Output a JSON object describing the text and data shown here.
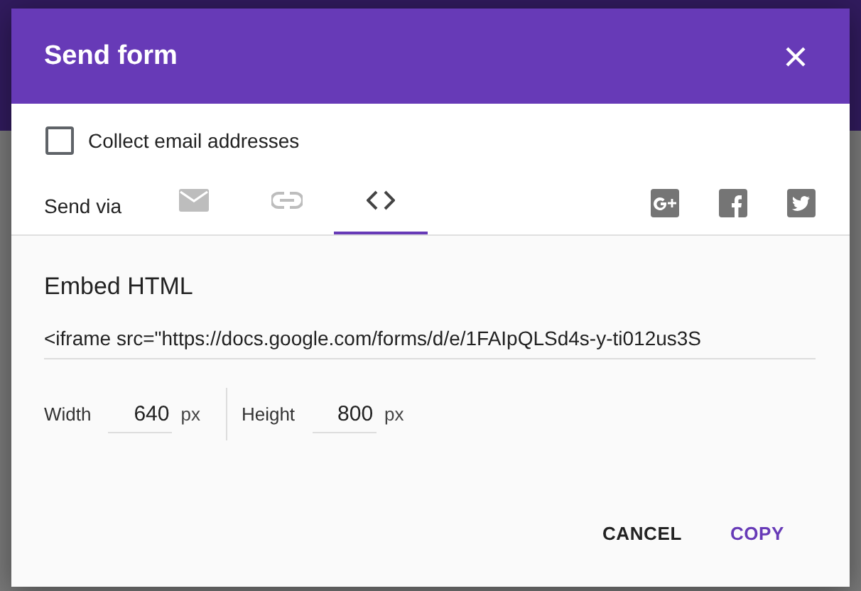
{
  "dialog": {
    "title": "Send form",
    "collect_email": {
      "label": "Collect email addresses",
      "checked": false
    }
  },
  "send_via": {
    "label": "Send via",
    "tabs": [
      {
        "kind": "email",
        "selected": false
      },
      {
        "kind": "link",
        "selected": false
      },
      {
        "kind": "embed",
        "selected": true
      }
    ],
    "share": [
      {
        "kind": "google-plus"
      },
      {
        "kind": "facebook"
      },
      {
        "kind": "twitter"
      }
    ]
  },
  "embed": {
    "heading": "Embed HTML",
    "code": "<iframe src=\"https://docs.google.com/forms/d/e/1FAIpQLSd4s-y-ti012us3S",
    "width": {
      "label": "Width",
      "value": "640",
      "unit": "px"
    },
    "height": {
      "label": "Height",
      "value": "800",
      "unit": "px"
    }
  },
  "buttons": [
    {
      "label": "CANCEL",
      "primary": false
    },
    {
      "label": "COPY",
      "primary": true
    }
  ]
}
